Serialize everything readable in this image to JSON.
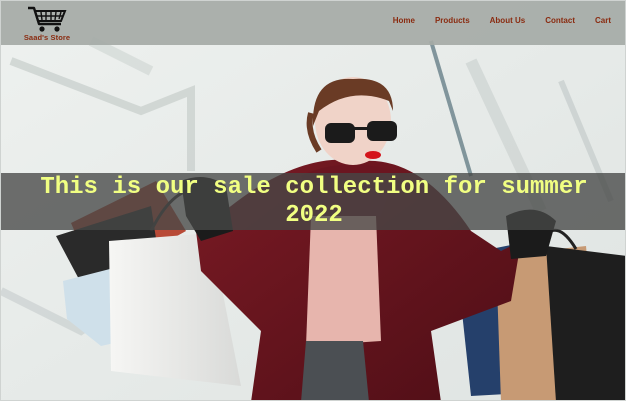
{
  "store": {
    "name": "Saad's Store",
    "logo_icon": "shopping-cart-icon"
  },
  "nav": {
    "items": [
      {
        "label": "Home"
      },
      {
        "label": "Products"
      },
      {
        "label": "About Us"
      },
      {
        "label": "Contact"
      },
      {
        "label": "Cart"
      }
    ]
  },
  "hero": {
    "headline": "This is our sale collection for summer 2022",
    "image": "woman-with-shopping-bags-photo"
  },
  "colors": {
    "nav_background": "#a5aaa6",
    "nav_text": "#8a2b10",
    "banner_background": "#464846",
    "headline_text": "#f1ff82"
  }
}
